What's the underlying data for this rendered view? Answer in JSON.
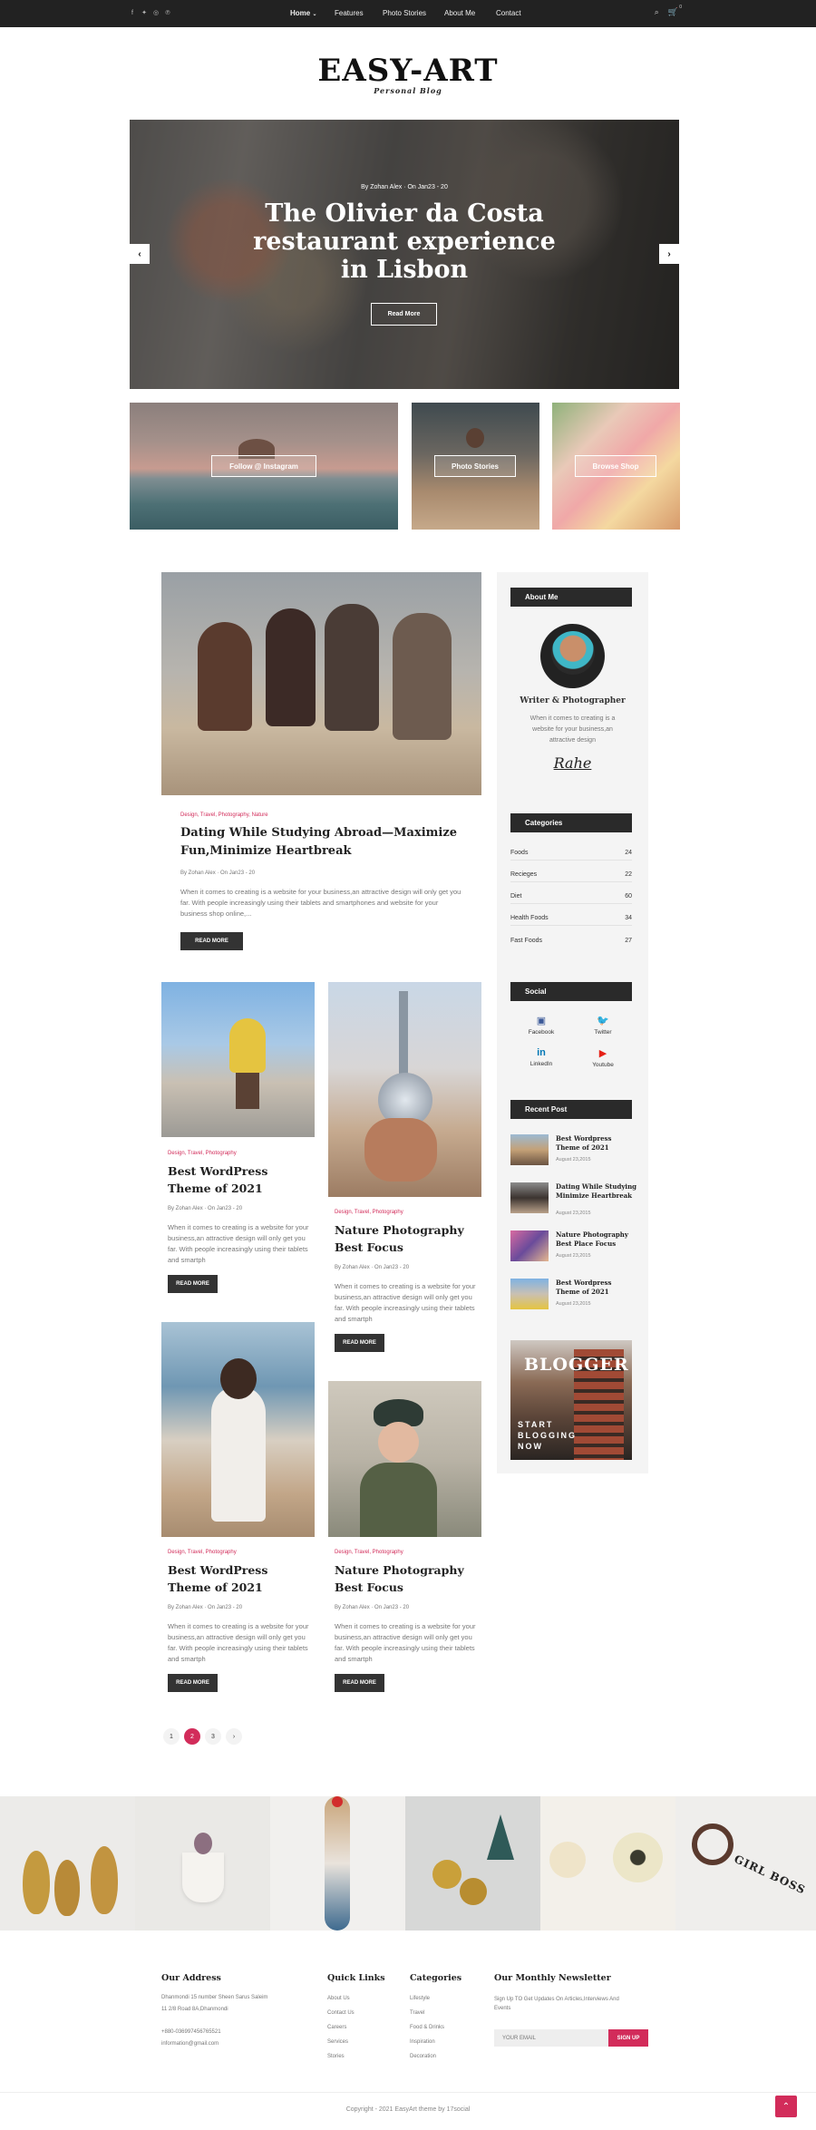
{
  "topbar": {
    "social_icons": [
      "facebook-icon",
      "twitter-icon",
      "instagram-icon",
      "pinterest-icon"
    ],
    "nav": [
      {
        "label": "Home",
        "caret": "⌄"
      },
      {
        "label": "Features"
      },
      {
        "label": "Photo Stories"
      },
      {
        "label": "About Me"
      },
      {
        "label": "Contact"
      }
    ],
    "cart_count": "0"
  },
  "logo": {
    "title": "EASY-ART",
    "subtitle": "Personal Blog"
  },
  "hero": {
    "meta": "By Zohan Alex  ·  On Jan23 - 20",
    "title": "The Olivier da Costa restaurant experience in Lisbon",
    "button": "Read More"
  },
  "tiles": [
    {
      "label": "Follow @ Instagram"
    },
    {
      "label": "Photo Stories"
    },
    {
      "label": "Browse Shop"
    }
  ],
  "featured": {
    "categories": "Design, Travel, Photography, Nature",
    "title": "Dating While Studying Abroad—Maximize Fun,Minimize Heartbreak",
    "meta": "By Zohan Alex  ·  On Jan23 - 20",
    "excerpt": "When it comes to creating is a website for your business,an attractive design will only get you far. With people increasingly using their tablets and smartphones and website for your business shop online,...",
    "button": "READ MORE"
  },
  "posts": [
    {
      "categories": "Design, Travel, Photography",
      "title": "Best WordPress Theme of 2021",
      "meta": "By Zohan Alex  ·  On Jan23 - 20",
      "excerpt": "When it comes to creating is a website for your business,an attractive design will only get you far. With people increasingly using their tablets and smartph",
      "button": "READ MORE"
    },
    {
      "categories": "Design, Travel, Photography",
      "title": "Nature Photography Best Focus",
      "meta": "By Zohan Alex  ·  On Jan23 - 20",
      "excerpt": "When it comes to creating is a website for your business,an attractive design will only get you far. With people increasingly using their tablets and smartph",
      "button": "READ MORE"
    },
    {
      "categories": "Design, Travel, Photography",
      "title": "Best WordPress Theme of 2021",
      "meta": "By Zohan Alex  ·  On Jan23 - 20",
      "excerpt": "When it comes to creating is a website for your business,an attractive design will only get you far. With people increasingly using their tablets and smartph",
      "button": "READ MORE"
    },
    {
      "categories": "Design, Travel, Photography",
      "title": "Nature Photography Best Focus",
      "meta": "By Zohan Alex  ·  On Jan23 - 20",
      "excerpt": "When it comes to creating is a website for your business,an attractive design will only get you far. With people increasingly using their tablets and smartph",
      "button": "READ MORE"
    }
  ],
  "pagination": {
    "pages": [
      "1",
      "2",
      "3"
    ],
    "current": "2",
    "next": "›"
  },
  "sidebar": {
    "about": {
      "title": "About Me",
      "role": "Writer & Photographer",
      "text": "When it comes to creating is a website for your business,an attractive design",
      "signature": "Rahe"
    },
    "categories": {
      "title": "Categories",
      "items": [
        {
          "name": "Foods",
          "count": "24"
        },
        {
          "name": "Recieges",
          "count": "22"
        },
        {
          "name": "Diet",
          "count": "60"
        },
        {
          "name": "Health Foods",
          "count": "34"
        },
        {
          "name": "Fast Foods",
          "count": "27"
        }
      ]
    },
    "social": {
      "title": "Social",
      "items": [
        {
          "name": "Facebook",
          "icon": "facebook-icon",
          "color": "#3b5998"
        },
        {
          "name": "Twitter",
          "icon": "twitter-icon",
          "color": "#1da1f2"
        },
        {
          "name": "LinkedIn",
          "icon": "linkedin-icon",
          "color": "#0077b5"
        },
        {
          "name": "Youtube",
          "icon": "youtube-icon",
          "color": "#e62117"
        }
      ]
    },
    "recent": {
      "title": "Recent Post",
      "items": [
        {
          "title": "Best Wordpress Theme of 2021",
          "date": "August 23,2015"
        },
        {
          "title": "Dating While Studying Minimize Heartbreak",
          "date": "August 23,2015"
        },
        {
          "title": "Nature Photography Best Place Focus",
          "date": "August 23,2015"
        },
        {
          "title": "Best Wordpress Theme of 2021",
          "date": "August 23,2015"
        }
      ]
    },
    "banner": {
      "top": "BLOGGER",
      "line1": "START",
      "line2": "BLOGGING",
      "line3": "NOW"
    }
  },
  "footer": {
    "address": {
      "title": "Our Address",
      "lines": [
        "Dhanmondi 15 number Sheen Sarus Saleim",
        "11 2/8 Road 8A,Dhanmondi"
      ],
      "phone": "+880-036997456765521",
      "email": "information@gmail.com"
    },
    "quick": {
      "title": "Quick Links",
      "items": [
        "About Us",
        "Contact Us",
        "Careers",
        "Services",
        "Stories"
      ]
    },
    "cats": {
      "title": "Categories",
      "items": [
        "Lifestyle",
        "Travel",
        "Food & Drinks",
        "Inspiration",
        "Decoration"
      ]
    },
    "newsletter": {
      "title": "Our Monthly Newsletter",
      "text": "Sign Up TO Get Updates On Articles,Interviews And Events",
      "placeholder": "YOUR EMAIL",
      "button": "SIGN UP"
    },
    "copyright": "Copyright - 2021 EasyArt theme by  17social"
  },
  "accent": "#d22c5a"
}
